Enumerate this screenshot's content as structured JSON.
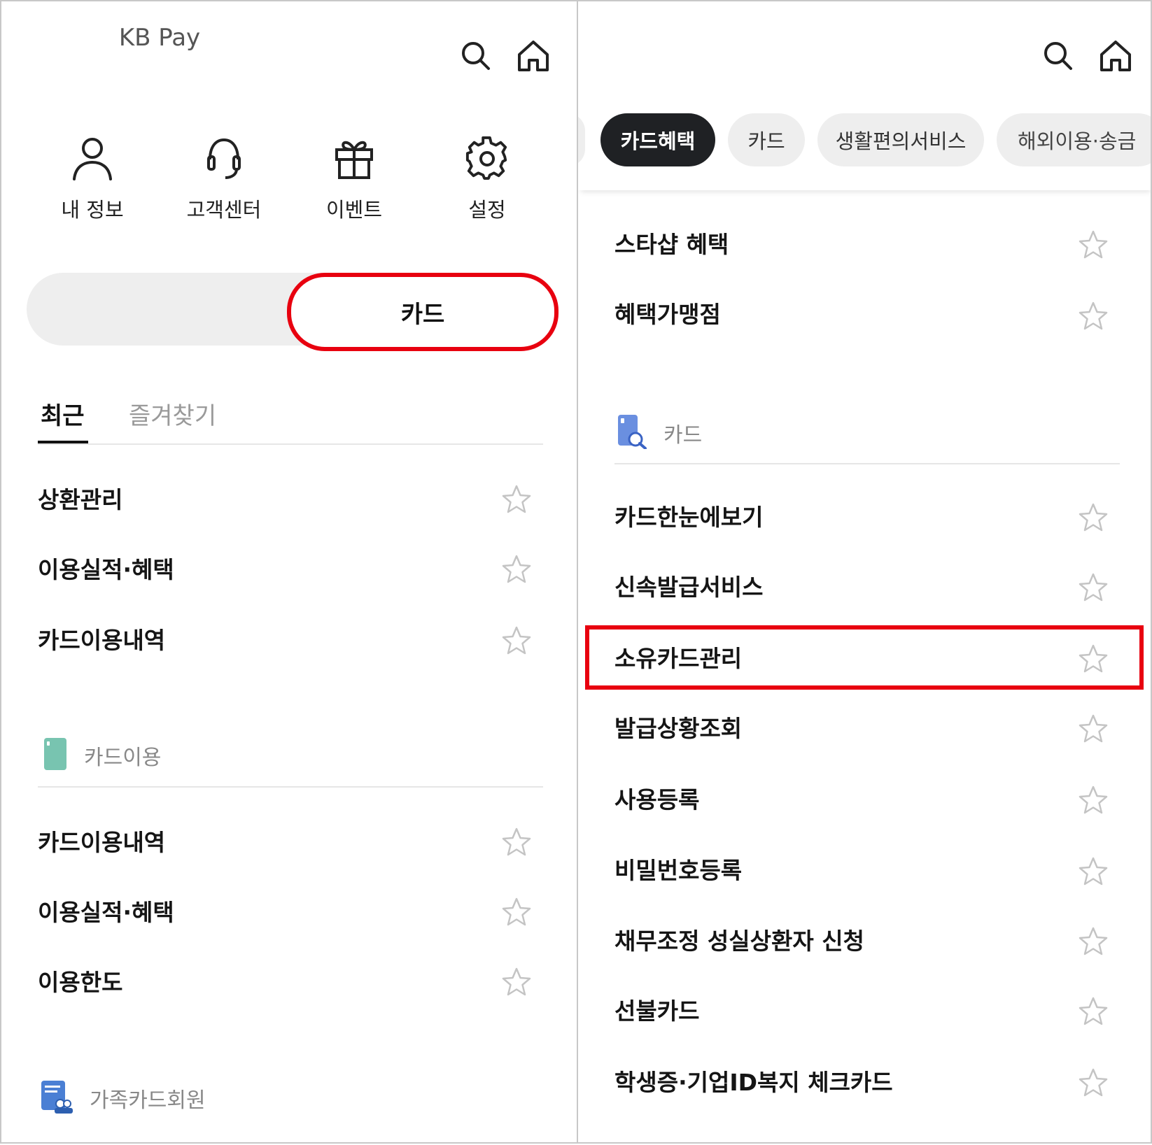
{
  "left": {
    "header": {
      "search_icon": "search-icon",
      "home_icon": "home-icon"
    },
    "quick_menu": [
      {
        "label": "내 정보",
        "icon": "person-icon"
      },
      {
        "label": "고객센터",
        "icon": "headset-icon"
      },
      {
        "label": "이벤트",
        "icon": "gift-icon"
      },
      {
        "label": "설정",
        "icon": "gear-icon"
      }
    ],
    "segment": {
      "options": [
        "KB Pay",
        "카드"
      ],
      "selected": "카드"
    },
    "tabs": {
      "recent": "최근",
      "favorites": "즐겨찾기",
      "active": "최근"
    },
    "recent_items": [
      "상환관리",
      "이용실적·혜택",
      "카드이용내역"
    ],
    "section_card_use": {
      "label": "카드이용",
      "color": "#78c4b0",
      "items": [
        "카드이용내역",
        "이용실적·혜택",
        "이용한도"
      ]
    },
    "section_family": {
      "label": "가족카드회원",
      "color": "#4a7fd4"
    }
  },
  "right": {
    "header": {
      "search_icon": "search-icon",
      "home_icon": "home-icon"
    },
    "chips": [
      "카드혜택",
      "카드",
      "생활편의서비스",
      "해외이용·송금"
    ],
    "chip_active": "카드혜택",
    "benefit_items": [
      "스타샵 혜택",
      "혜택가맹점"
    ],
    "section_card": {
      "label": "카드",
      "color": "#6a8fe0",
      "items": [
        "카드한눈에보기",
        "신속발급서비스",
        "소유카드관리",
        "발급상황조회",
        "사용등록",
        "비밀번호등록",
        "채무조정 성실상환자 신청",
        "선불카드",
        "학생증·기업ID복지 체크카드"
      ]
    },
    "highlighted_item": "소유카드관리"
  },
  "colors": {
    "highlight": "#e8000f",
    "chip_active_bg": "#1f2124",
    "star": "#c4c4c4"
  }
}
